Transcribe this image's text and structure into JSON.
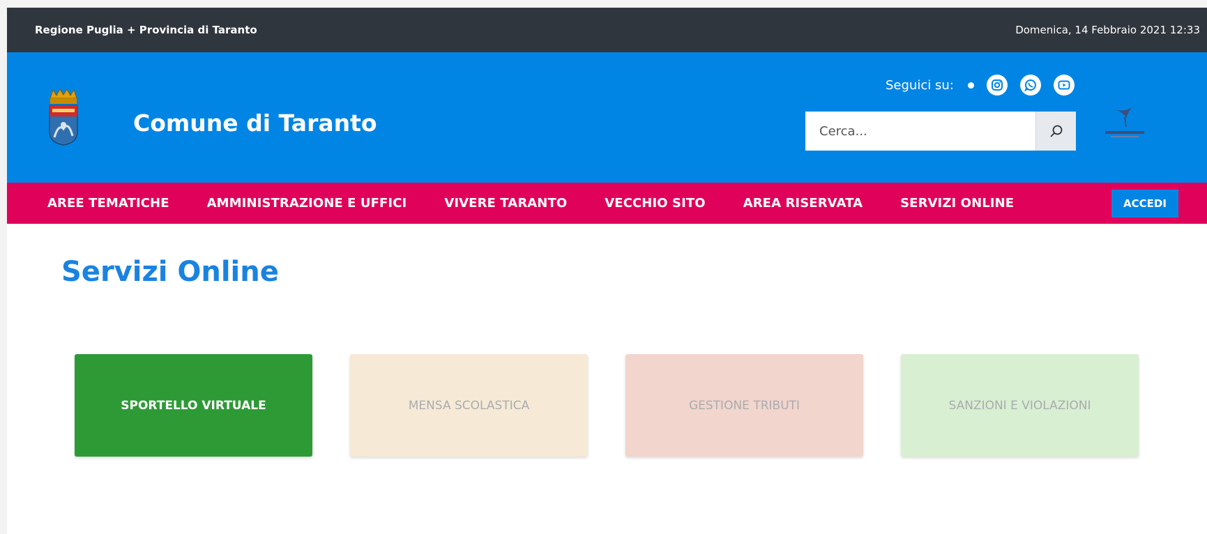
{
  "topbar": {
    "region": "Regione Puglia + Provincia di Taranto",
    "date": "Domenica, 14 Febbraio 2021 12:33"
  },
  "header": {
    "site_title": "Comune di Taranto",
    "social_label": "Seguici su:",
    "social_icons": [
      "instagram-icon",
      "whatsapp-icon",
      "youtube-icon"
    ],
    "search_placeholder": "Cerca..."
  },
  "nav": {
    "items": [
      {
        "label": "AREE TEMATICHE"
      },
      {
        "label": "AMMINISTRAZIONE E UFFICI"
      },
      {
        "label": "VIVERE TARANTO"
      },
      {
        "label": "VECCHIO SITO"
      },
      {
        "label": "AREA RISERVATA"
      },
      {
        "label": "SERVIZI ONLINE"
      }
    ],
    "login_label": "ACCEDI"
  },
  "main": {
    "title": "Servizi Online",
    "cards": [
      {
        "label": "SPORTELLO VIRTUALE",
        "bg": "#2e9a36",
        "active": true
      },
      {
        "label": "MENSA SCOLASTICA",
        "bg": "#f6ead6",
        "active": false
      },
      {
        "label": "GESTIONE TRIBUTI",
        "bg": "#f2d5cc",
        "active": false
      },
      {
        "label": "SANZIONI E VIOLAZIONI",
        "bg": "#d8efd1",
        "active": false
      }
    ]
  },
  "colors": {
    "topbar": "#30363d",
    "header": "#0085e5",
    "nav": "#e0025a",
    "title": "#1a83e0"
  }
}
